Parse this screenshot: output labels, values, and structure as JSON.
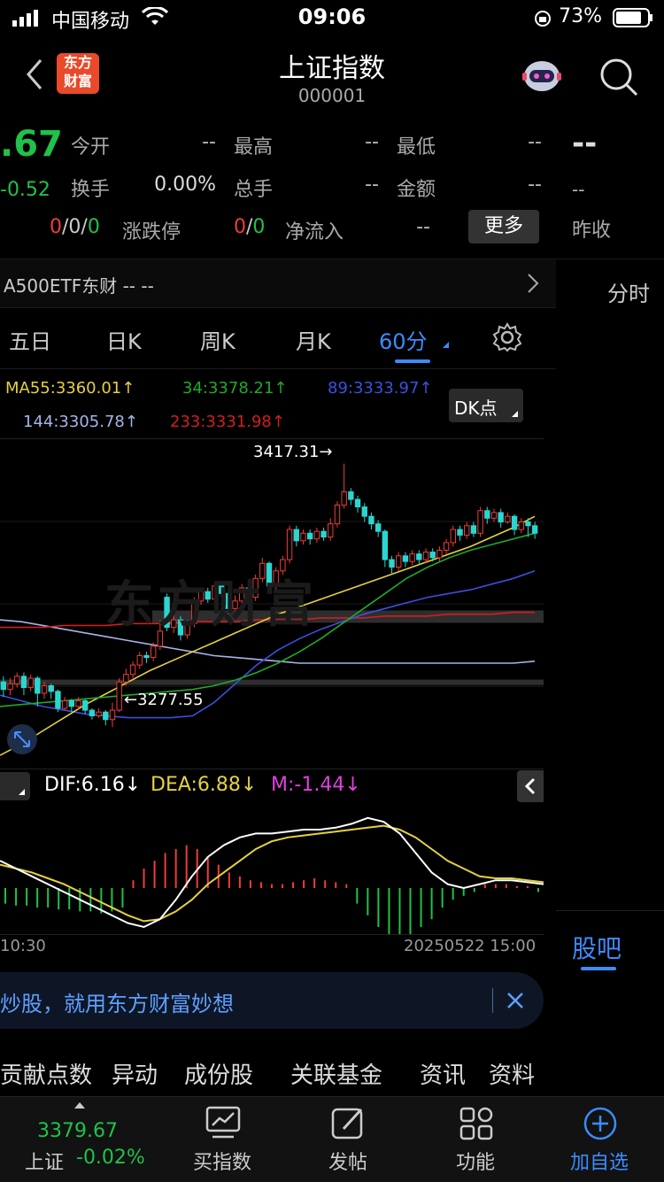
{
  "status_bar": {
    "carrier": "中国移动",
    "time": "09:06",
    "battery": "73%"
  },
  "header": {
    "title": "上证指数",
    "code": "000001",
    "logo_line1": "东方",
    "logo_line2": "财富"
  },
  "quote": {
    "price_partial": ".67",
    "change_partial": "-0.52",
    "open_label": "今开",
    "open_value": "--",
    "high_label": "最高",
    "high_value": "--",
    "low_label": "最低",
    "low_value": "--",
    "turnover_label": "换手",
    "turnover_value": "0.00%",
    "total_label": "总手",
    "total_value": "--",
    "amount_label": "金额",
    "amount_value": "--",
    "updown_a": "0",
    "updown_b": "0",
    "updown_c": "0",
    "updown_label": "涨跌停",
    "limit_a": "0",
    "limit_b": "0",
    "netflow_label": "净流入",
    "netflow_value": "--",
    "more_button": "更多",
    "right_price": "--",
    "right_sub": "--",
    "prev_close_label": "昨收"
  },
  "etf": {
    "label": "A500ETF东财",
    "value1": "--",
    "value2": "--"
  },
  "right_tab": "分时",
  "tabs": [
    "五日",
    "日K",
    "周K",
    "月K",
    "60分"
  ],
  "ma": {
    "ma55": "MA55:3360.01↑",
    "ma34": "34:3378.21↑",
    "ma89": "89:3333.97↑",
    "ma144": "144:3305.78↑",
    "ma233": "233:3331.98↑",
    "dk_button": "DK点"
  },
  "colors": {
    "up": "#f23b3b",
    "down": "#1fc24a",
    "ma55": "#e6d23c",
    "ma34": "#1faa2a",
    "ma89": "#3d4fe0",
    "ma144": "#a8b4e8",
    "ma233": "#d21e1e",
    "accent": "#3b8cff"
  },
  "chart_labels": {
    "high": "3417.31→",
    "low": "←3277.55",
    "watermark": "东方财富"
  },
  "macd": {
    "dif": "DIF:6.16↓",
    "dea": "DEA:6.88↓",
    "m": "M:-1.44↓"
  },
  "xaxis": {
    "left": "10:30",
    "right": "20250522 15:00"
  },
  "banner": {
    "text": "炒股，就用东方财富妙想"
  },
  "guba": "股吧",
  "bottom_tabs": [
    "贡献点数",
    "异动",
    "成份股",
    "关联基金",
    "资讯",
    "资料"
  ],
  "nav": {
    "index_price": "3379.67",
    "index_name": "上证",
    "index_change": "-0.02%",
    "buy": "买指数",
    "post": "发帖",
    "func": "功能",
    "add": "加自选"
  },
  "chart_data": {
    "type": "candlestick",
    "ylim": [
      3255,
      3430
    ],
    "candles": [
      [
        3301,
        3297,
        3304,
        3293
      ],
      [
        3297,
        3300,
        3303,
        3294
      ],
      [
        3300,
        3304,
        3306,
        3298
      ],
      [
        3304,
        3298,
        3306,
        3294
      ],
      [
        3298,
        3303,
        3305,
        3296
      ],
      [
        3303,
        3295,
        3304,
        3288
      ],
      [
        3295,
        3299,
        3301,
        3292
      ],
      [
        3299,
        3296,
        3300,
        3292
      ],
      [
        3296,
        3287,
        3297,
        3285
      ],
      [
        3287,
        3291,
        3293,
        3286
      ],
      [
        3291,
        3288,
        3292,
        3285
      ],
      [
        3288,
        3291,
        3293,
        3286
      ],
      [
        3291,
        3286,
        3292,
        3284
      ],
      [
        3286,
        3283,
        3287,
        3281
      ],
      [
        3283,
        3285,
        3287,
        3282
      ],
      [
        3285,
        3281,
        3286,
        3278
      ],
      [
        3281,
        3286,
        3290,
        3277
      ],
      [
        3286,
        3301,
        3303,
        3285
      ],
      [
        3301,
        3305,
        3308,
        3299
      ],
      [
        3305,
        3310,
        3312,
        3303
      ],
      [
        3310,
        3315,
        3317,
        3308
      ],
      [
        3315,
        3314,
        3317,
        3311
      ],
      [
        3314,
        3320,
        3322,
        3312
      ],
      [
        3320,
        3328,
        3334,
        3318
      ],
      [
        3346,
        3330,
        3348,
        3328
      ],
      [
        3330,
        3334,
        3337,
        3327
      ],
      [
        3334,
        3326,
        3336,
        3323
      ],
      [
        3326,
        3332,
        3334,
        3324
      ],
      [
        3332,
        3344,
        3346,
        3330
      ],
      [
        3344,
        3349,
        3351,
        3342
      ],
      [
        3349,
        3345,
        3351,
        3343
      ],
      [
        3345,
        3352,
        3354,
        3343
      ],
      [
        3352,
        3348,
        3354,
        3346
      ],
      [
        3348,
        3340,
        3350,
        3337
      ],
      [
        3340,
        3344,
        3347,
        3339
      ],
      [
        3344,
        3351,
        3353,
        3342
      ],
      [
        3351,
        3346,
        3353,
        3343
      ],
      [
        3346,
        3356,
        3358,
        3344
      ],
      [
        3356,
        3364,
        3367,
        3354
      ],
      [
        3364,
        3352,
        3365,
        3349
      ],
      [
        3352,
        3360,
        3362,
        3350
      ],
      [
        3360,
        3366,
        3368,
        3358
      ],
      [
        3366,
        3382,
        3384,
        3364
      ],
      [
        3382,
        3376,
        3384,
        3373
      ],
      [
        3376,
        3380,
        3382,
        3374
      ],
      [
        3380,
        3377,
        3382,
        3374
      ],
      [
        3377,
        3381,
        3383,
        3375
      ],
      [
        3381,
        3378,
        3383,
        3376
      ],
      [
        3378,
        3385,
        3388,
        3376
      ],
      [
        3385,
        3395,
        3397,
        3383
      ],
      [
        3395,
        3402,
        3417,
        3393
      ],
      [
        3402,
        3398,
        3404,
        3395
      ],
      [
        3398,
        3394,
        3400,
        3391
      ],
      [
        3394,
        3389,
        3396,
        3386
      ],
      [
        3389,
        3385,
        3391,
        3382
      ],
      [
        3385,
        3381,
        3387,
        3378
      ],
      [
        3381,
        3366,
        3382,
        3362
      ],
      [
        3366,
        3362,
        3368,
        3358
      ],
      [
        3362,
        3368,
        3370,
        3360
      ],
      [
        3368,
        3365,
        3370,
        3362
      ],
      [
        3365,
        3369,
        3371,
        3363
      ],
      [
        3369,
        3366,
        3371,
        3363
      ],
      [
        3366,
        3370,
        3372,
        3364
      ],
      [
        3370,
        3367,
        3372,
        3365
      ],
      [
        3367,
        3371,
        3373,
        3365
      ],
      [
        3371,
        3375,
        3377,
        3369
      ],
      [
        3375,
        3382,
        3384,
        3373
      ],
      [
        3382,
        3379,
        3384,
        3376
      ],
      [
        3379,
        3384,
        3386,
        3377
      ],
      [
        3384,
        3380,
        3386,
        3378
      ],
      [
        3380,
        3392,
        3394,
        3378
      ],
      [
        3392,
        3388,
        3394,
        3385
      ],
      [
        3388,
        3391,
        3393,
        3386
      ],
      [
        3391,
        3386,
        3393,
        3383
      ],
      [
        3386,
        3389,
        3391,
        3385
      ],
      [
        3389,
        3382,
        3390,
        3379
      ],
      [
        3382,
        3386,
        3388,
        3380
      ],
      [
        3386,
        3384,
        3388,
        3378
      ],
      [
        3384,
        3380,
        3386,
        3377
      ]
    ],
    "ma34": [
      3288,
      3289,
      3290,
      3291,
      3292,
      3293,
      3294,
      3295,
      3296,
      3297,
      3299,
      3302,
      3306,
      3311,
      3317,
      3324,
      3332,
      3340,
      3348,
      3356,
      3362,
      3367,
      3371,
      3374,
      3377,
      3380
    ],
    "ma55": [
      3262,
      3268,
      3275,
      3282,
      3289,
      3295,
      3301,
      3307,
      3312,
      3317,
      3322,
      3327,
      3332,
      3337,
      3341,
      3345,
      3349,
      3353,
      3357,
      3361,
      3365,
      3369,
      3373,
      3378,
      3383,
      3389
    ],
    "ma89": [
      3294,
      3291,
      3288,
      3286,
      3284,
      3283,
      3282,
      3282,
      3282,
      3283,
      3290,
      3300,
      3310,
      3318,
      3324,
      3329,
      3333,
      3337,
      3340,
      3343,
      3346,
      3348,
      3350,
      3353,
      3356,
      3360
    ],
    "ma144": [
      3334,
      3333,
      3331,
      3329,
      3327,
      3325,
      3323,
      3321,
      3319,
      3317,
      3315,
      3314,
      3313,
      3312,
      3311,
      3311,
      3311,
      3311,
      3311,
      3311,
      3311,
      3311,
      3311,
      3311,
      3311,
      3312
    ],
    "ma233": [
      3330,
      3330,
      3330,
      3331,
      3331,
      3331,
      3332,
      3332,
      3332,
      3333,
      3333,
      3333,
      3334,
      3334,
      3334,
      3335,
      3335,
      3335,
      3336,
      3336,
      3336,
      3337,
      3337,
      3337,
      3338,
      3338
    ],
    "macd_dif": [
      14,
      10,
      6,
      2,
      -2,
      -6,
      -10,
      -14,
      -18,
      -20,
      -16,
      -6,
      6,
      16,
      22,
      26,
      28,
      28,
      29,
      30,
      30,
      31,
      33,
      36,
      34,
      28,
      18,
      8,
      2,
      0,
      2,
      4,
      4,
      3,
      2
    ],
    "macd_dea": [
      12,
      10,
      8,
      5,
      2,
      -2,
      -6,
      -10,
      -14,
      -17,
      -16,
      -12,
      -6,
      2,
      8,
      14,
      20,
      24,
      26,
      27,
      28,
      29,
      30,
      31,
      32,
      30,
      26,
      20,
      14,
      10,
      6,
      5,
      5,
      4,
      3
    ],
    "macd_hist": [
      -8,
      -9,
      -9,
      -10,
      -10,
      -11,
      -11,
      -12,
      -12,
      -13,
      -12,
      -10,
      4,
      10,
      14,
      18,
      20,
      22,
      20,
      16,
      12,
      8,
      6,
      4,
      3,
      2,
      2,
      3,
      4,
      5,
      4,
      3,
      2,
      -8,
      -14,
      -20,
      -24,
      -26,
      -24,
      -20,
      -16,
      -10,
      -6,
      -4,
      -2,
      2,
      2,
      2,
      1,
      1,
      -2
    ]
  }
}
